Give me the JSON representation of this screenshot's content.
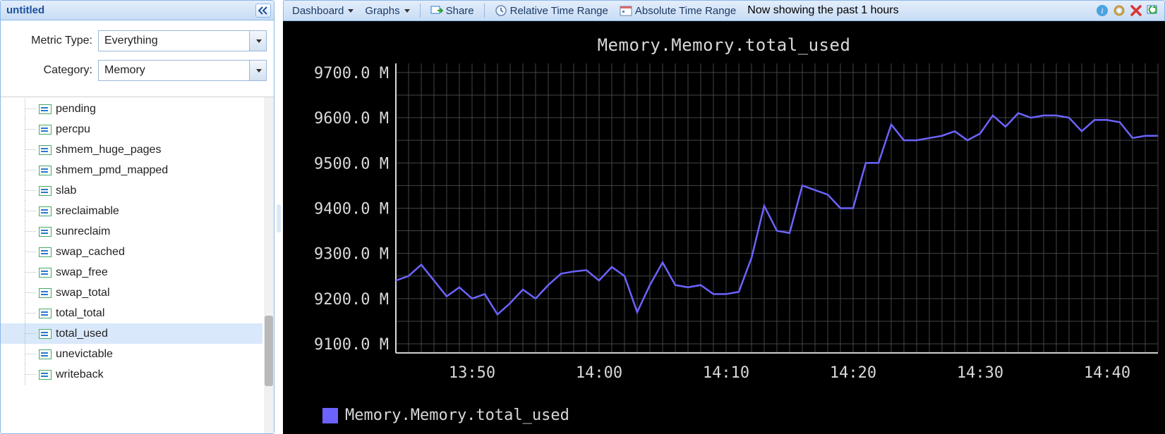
{
  "sidebar": {
    "title": "untitled",
    "filters": {
      "metric_type_label": "Metric Type:",
      "metric_type_value": "Everything",
      "category_label": "Category:",
      "category_value": "Memory"
    },
    "tree_items": [
      "pending",
      "percpu",
      "shmem_huge_pages",
      "shmem_pmd_mapped",
      "slab",
      "sreclaimable",
      "sunreclaim",
      "swap_cached",
      "swap_free",
      "swap_total",
      "total_total",
      "total_used",
      "unevictable",
      "writeback"
    ],
    "selected_item": "total_used"
  },
  "toolbar": {
    "dashboard": "Dashboard",
    "graphs": "Graphs",
    "share": "Share",
    "relative": "Relative Time Range",
    "absolute": "Absolute Time Range",
    "status": "Now showing the past 1 hours"
  },
  "chart_data": {
    "type": "line",
    "title": "Memory.Memory.total_used",
    "ylabel": "",
    "xlabel": "",
    "y_ticks": [
      "9100.0 M",
      "9200.0 M",
      "9300.0 M",
      "9400.0 M",
      "9500.0 M",
      "9600.0 M",
      "9700.0 M"
    ],
    "y_values": [
      9100,
      9200,
      9300,
      9400,
      9500,
      9600,
      9700
    ],
    "ylim": [
      9080,
      9720
    ],
    "x_ticks": [
      "13:50",
      "14:00",
      "14:10",
      "14:20",
      "14:30",
      "14:40"
    ],
    "x_tick_minutes": [
      830,
      840,
      850,
      860,
      870,
      880
    ],
    "xlim_minutes": [
      824,
      884
    ],
    "series": [
      {
        "name": "Memory.Memory.total_used",
        "color": "#6c63ff",
        "x_minutes": [
          824,
          825,
          826,
          827,
          828,
          829,
          830,
          831,
          832,
          833,
          834,
          835,
          836,
          837,
          838,
          839,
          840,
          841,
          842,
          843,
          844,
          845,
          846,
          847,
          848,
          849,
          850,
          851,
          852,
          853,
          854,
          855,
          856,
          857,
          858,
          859,
          860,
          861,
          862,
          863,
          864,
          865,
          866,
          867,
          868,
          869,
          870,
          871,
          872,
          873,
          874,
          875,
          876,
          877,
          878,
          879,
          880,
          881,
          882,
          883,
          884
        ],
        "y": [
          9240,
          9250,
          9275,
          9240,
          9205,
          9225,
          9200,
          9210,
          9165,
          9190,
          9220,
          9200,
          9230,
          9255,
          9260,
          9263,
          9240,
          9270,
          9250,
          9170,
          9230,
          9280,
          9230,
          9225,
          9230,
          9210,
          9210,
          9215,
          9290,
          9405,
          9350,
          9345,
          9450,
          9440,
          9430,
          9400,
          9400,
          9500,
          9500,
          9585,
          9550,
          9550,
          9555,
          9560,
          9570,
          9550,
          9565,
          9605,
          9580,
          9610,
          9600,
          9605,
          9605,
          9600,
          9570,
          9595,
          9595,
          9590,
          9555,
          9560,
          9560
        ]
      }
    ],
    "legend": [
      "Memory.Memory.total_used"
    ]
  }
}
